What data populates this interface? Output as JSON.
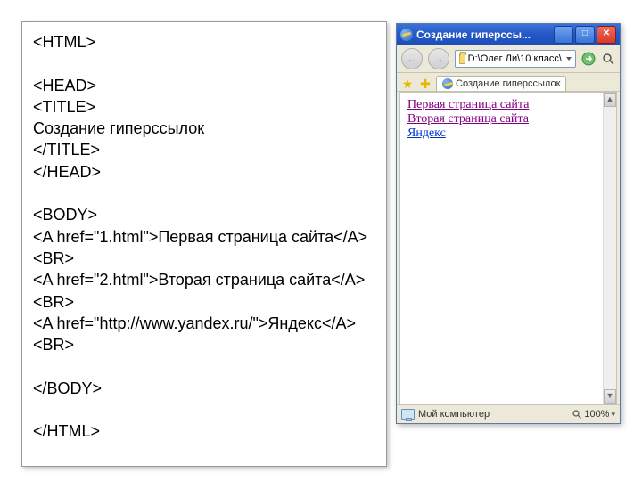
{
  "code_block": "<HTML>\n\n<HEAD>\n<TITLE>\nСоздание гиперссылок\n</TITLE>\n</HEAD>\n\n<BODY>\n<A href=\"1.html\">Первая страница сайта</A><BR>\n<A href=\"2.html\">Вторая страница сайта</A><BR>\n<A href=\"http://www.yandex.ru/\">Яндекс</A><BR>\n\n</BODY>\n\n</HTML>",
  "browser": {
    "title": "Создание гиперссы...",
    "address": "D:\\Олег Ли\\10 класс\\",
    "tab_label": "Создание гиперссылок",
    "links": {
      "l1": "Первая страница сайта",
      "l2": "Вторая страница сайта",
      "l3": "Яндекс"
    },
    "status_zone": "Мой компьютер",
    "zoom": "100%",
    "winbtns": {
      "min": "_",
      "max": "□",
      "close": "✕"
    },
    "nav": {
      "back": "←",
      "fwd": "→"
    },
    "scroll": {
      "up": "▲",
      "down": "▼"
    },
    "zoom_drop": "▾"
  }
}
